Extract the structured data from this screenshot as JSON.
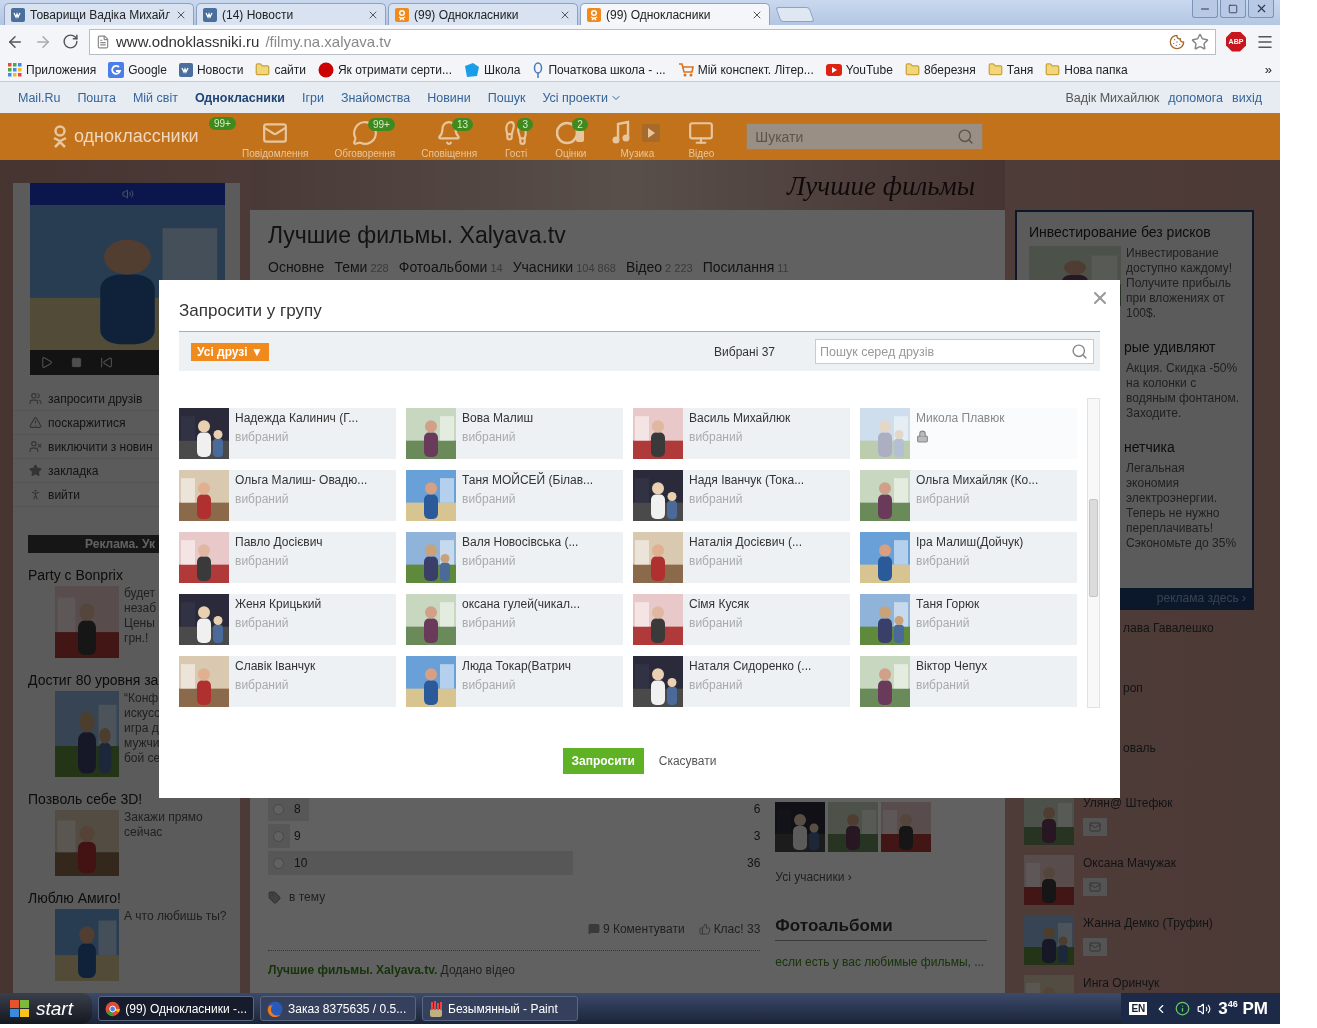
{
  "browser_tabs": [
    {
      "title": "Товарищи Вадіка Михайл",
      "kind": "vk",
      "selected": false
    },
    {
      "title": "(14) Новости",
      "kind": "vk",
      "selected": false
    },
    {
      "title": "(99) Однокласники",
      "kind": "ok",
      "selected": false
    },
    {
      "title": "(99) Однокласники",
      "kind": "ok",
      "selected": true
    }
  ],
  "address": {
    "host": "www.odnoklassniki.ru",
    "path": "/filmy.na.xalyava.tv"
  },
  "extension_badge": "ABP",
  "bookmarks": [
    {
      "label": "Приложения",
      "kind": "apps"
    },
    {
      "label": "Google",
      "kind": "google"
    },
    {
      "label": "Новости",
      "kind": "vk"
    },
    {
      "label": "сайти",
      "kind": "folder"
    },
    {
      "label": "Як отримати серти...",
      "kind": "dot"
    },
    {
      "label": "Школа",
      "kind": "school"
    },
    {
      "label": "Початкова школа - ...",
      "kind": "pin"
    },
    {
      "label": "Мій конспект. Літер...",
      "kind": "cart"
    },
    {
      "label": "YouTube",
      "kind": "youtube"
    },
    {
      "label": "8березня",
      "kind": "folder"
    },
    {
      "label": "Таня",
      "kind": "folder"
    },
    {
      "label": "Нова папка",
      "kind": "folder"
    }
  ],
  "bookmarks_more": "»",
  "portal_nav": {
    "items": [
      {
        "label": "Mail.Ru",
        "selected": false
      },
      {
        "label": "Пошта",
        "selected": false
      },
      {
        "label": "Мій світ",
        "selected": false
      },
      {
        "label": "Однокласники",
        "selected": true
      },
      {
        "label": "Ігри",
        "selected": false
      },
      {
        "label": "Знайомства",
        "selected": false
      },
      {
        "label": "Новини",
        "selected": false
      },
      {
        "label": "Пошук",
        "selected": false
      }
    ],
    "menu": "Усі проекти",
    "user": "Вадік Михайлюк",
    "links": [
      "допомога",
      "вихід"
    ]
  },
  "header": {
    "logo": "одноклассники",
    "logo_badge": "99+",
    "nav": [
      {
        "label": "Повідомлення",
        "kind": "mail"
      },
      {
        "label": "Обговорення",
        "kind": "chat",
        "badge": "99+"
      },
      {
        "label": "Сповіщення",
        "kind": "bell",
        "badge": "13"
      },
      {
        "label": "Гості",
        "kind": "steps",
        "badge": "3"
      },
      {
        "label": "Оцінки",
        "kind": "rating",
        "badge": "2"
      },
      {
        "label": "Музика",
        "kind": "music"
      },
      {
        "label": "Відео",
        "kind": "video"
      }
    ],
    "search": {
      "placeholder": "Шукати"
    }
  },
  "left": {
    "menu": [
      {
        "label": "запросити друзів",
        "kind": "users"
      },
      {
        "label": "поскаржитися",
        "kind": "warning"
      },
      {
        "label": "виключити з новин",
        "kind": "exclude"
      },
      {
        "label": "закладка",
        "kind": "star"
      },
      {
        "label": "вийти",
        "kind": "exit"
      }
    ],
    "ads_heading": "Реклама. Ук",
    "ads": [
      {
        "title": "Party с Bonprix",
        "lines": [
          "будет",
          "незаб",
          "Цены",
          "грн.!"
        ]
      },
      {
        "title": "Достиг 80 уровня за",
        "lines": [
          "“Конф",
          "искусс",
          "игра д",
          "мужчи",
          "бой се"
        ]
      },
      {
        "title": "Позволь себе 3D!",
        "lines": [
          "Закажи прямо",
          "сейчас"
        ]
      },
      {
        "title": "Люблю Амиго!",
        "lines": [
          "А что любишь ты?"
        ]
      }
    ]
  },
  "group": {
    "banner_caption": "Лучшие фильмы",
    "title": "Лучшие фильмы. Xalyava.tv",
    "tabs": [
      {
        "label": "Основне"
      },
      {
        "label": "Теми",
        "count": "228"
      },
      {
        "label": "Фотоальбоми",
        "count": "14"
      },
      {
        "label": "Учасники",
        "count": "104 868"
      },
      {
        "label": "Відео",
        "count": "2 223"
      },
      {
        "label": "Посилання",
        "count": "11"
      }
    ],
    "poll": [
      {
        "label": "8",
        "count": "6",
        "level": 0.084,
        "selected": false
      },
      {
        "label": "9",
        "count": "3",
        "level": 0.045,
        "selected": false
      },
      {
        "label": "10",
        "count": "36",
        "level": 0.62,
        "selected": false
      }
    ],
    "tag": "в тему",
    "comments": "9 Коментувати",
    "likes": "Клас! 33",
    "feed": "**Лучшие фильмы. Xalyava.tv.** Додано відео",
    "members_link": "Усі учасники ›",
    "albums_title": "Фотоальбоми",
    "album_caption": "если есть у вас любимые фильмы, ..."
  },
  "right": {
    "ads": [
      {
        "kind": "full",
        "title": "Инвестирование без рисков",
        "text": "Инвестирование доступно каждому! Получите прибыль при вложениях от 100$."
      },
      {
        "kind": "cut",
        "title": "рые удивляют",
        "text": "Акция. Скидка -50% на колонки с водяным фонтаном. Заходите."
      },
      {
        "kind": "cut",
        "title": "нетчика",
        "text": "Легальная экономия электроэнергии. Теперь не нужно переплачивать! Сэкономьте до 35%"
      }
    ],
    "ads_footer": "реклама здесь ›",
    "friends": [
      {
        "name": "лава Гавалешко",
        "kind": "cut"
      },
      {
        "name": "роп",
        "kind": "cut"
      },
      {
        "name": "оваль",
        "kind": "cut"
      },
      {
        "name": "Улян@ Штефюк",
        "kind": "full"
      },
      {
        "name": "Оксана Мачужак",
        "kind": "full"
      },
      {
        "name": "Жанна Демко (Труфин)",
        "kind": "full"
      },
      {
        "name": "Инга Оринчук",
        "kind": "clipped"
      }
    ]
  },
  "modal": {
    "title": "Запросити у групу",
    "filter": "Усі друзі ▼",
    "selected_count": "Вибрані 37",
    "search": {
      "placeholder": "Пошук серед друзів"
    },
    "friends": [
      {
        "name": "Надежда Калинич (Г...",
        "status": "вибраний",
        "locked": false
      },
      {
        "name": "Вова Малиш",
        "status": "вибраний",
        "locked": false
      },
      {
        "name": "Василь Михайлюк",
        "status": "вибраний",
        "locked": false
      },
      {
        "name": "Микола Плавюк",
        "locked": true
      },
      {
        "name": "Ольга Малиш- Овадю...",
        "status": "вибраний",
        "locked": false
      },
      {
        "name": "Таня МОЙСЕЙ (Білав...",
        "status": "вибраний",
        "locked": false
      },
      {
        "name": "Надя Іванчук (Тока...",
        "status": "вибраний",
        "locked": false
      },
      {
        "name": "Ольга Михайляк (Ко...",
        "status": "вибраний",
        "locked": false
      },
      {
        "name": "Павло Досієвич",
        "status": "вибраний",
        "locked": false
      },
      {
        "name": "Валя Новосівська (...",
        "status": "вибраний",
        "locked": false
      },
      {
        "name": "Наталія Досієвич (...",
        "status": "вибраний",
        "locked": false
      },
      {
        "name": "Іра Малиш(Дойчук)",
        "status": "вибраний",
        "locked": false
      },
      {
        "name": "Женя Крицький",
        "status": "вибраний",
        "locked": false
      },
      {
        "name": "оксана гулей(чикал...",
        "status": "вибраний",
        "locked": false
      },
      {
        "name": "Сімя Кусяк",
        "status": "вибраний",
        "locked": false
      },
      {
        "name": "Таня Горюк",
        "status": "вибраний",
        "locked": false
      },
      {
        "name": "Славік Іванчук",
        "status": "вибраний",
        "locked": false
      },
      {
        "name": "Люда Токар(Ватрич",
        "status": "вибраний",
        "locked": false
      },
      {
        "name": "Наталя Сидоренко (...",
        "status": "вибраний",
        "locked": false
      },
      {
        "name": "Віктор Чепух",
        "status": "вибраний",
        "locked": false
      }
    ],
    "submit": "Запросити",
    "cancel": "Скасувати"
  },
  "taskbar": {
    "start": "start",
    "items": [
      {
        "label": "(99) Однокласники -...",
        "kind": "chrome",
        "selected": true
      },
      {
        "label": "Заказ 8375635 / 0.5...",
        "kind": "firefox",
        "selected": false
      },
      {
        "label": "Безымянный - Paint",
        "kind": "paint",
        "selected": false
      }
    ],
    "language": "EN",
    "time": "3$^{46}$ PM"
  }
}
